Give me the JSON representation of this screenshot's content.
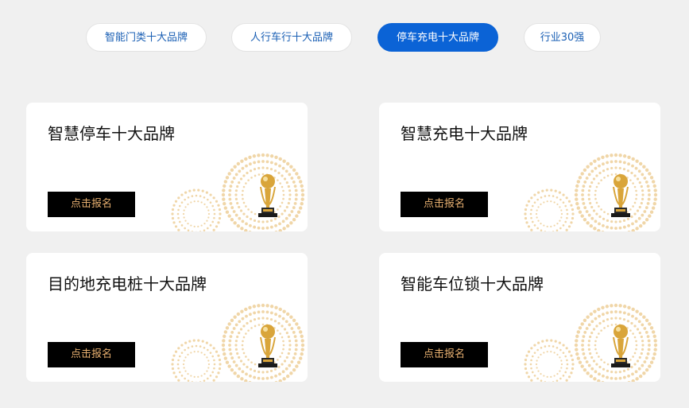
{
  "tabs": [
    {
      "label": "智能门类十大品牌",
      "active": false
    },
    {
      "label": "人行车行十大品牌",
      "active": false
    },
    {
      "label": "停车充电十大品牌",
      "active": true
    },
    {
      "label": "行业30强",
      "active": false
    }
  ],
  "cards": [
    {
      "title": "智慧停车十大品牌",
      "button_label": "点击报名"
    },
    {
      "title": "智慧充电十大品牌",
      "button_label": "点击报名"
    },
    {
      "title": "目的地充电桩十大品牌",
      "button_label": "点击报名"
    },
    {
      "title": "智能车位锁十大品牌",
      "button_label": "点击报名"
    }
  ],
  "colors": {
    "active_tab": "#0b63d6",
    "tab_text": "#1a5fb4",
    "button_bg": "#000000",
    "button_text": "#e8b070",
    "decor_dots": "#f0d6a8",
    "trophy_gold": "#d9a53a"
  },
  "icons": {
    "card_decoration": "trophy-icon"
  }
}
